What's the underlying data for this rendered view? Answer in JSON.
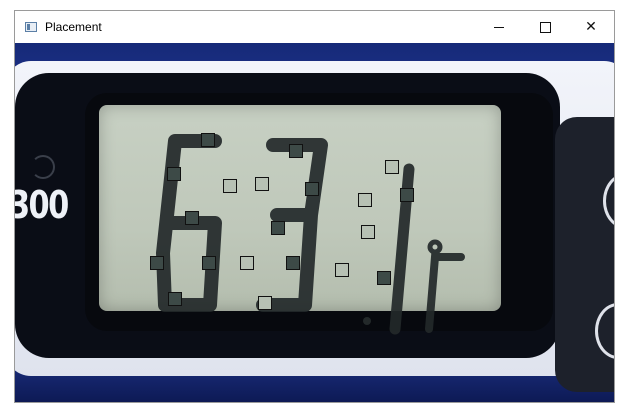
{
  "window": {
    "title": "Placement",
    "controls": {
      "minimize_icon": "minimize-icon",
      "maximize_icon": "maximize-icon",
      "close_icon": "close-icon",
      "close_glyph": "✕"
    }
  },
  "photo": {
    "brand_digits": "300",
    "reading": "63.1c"
  },
  "markers": {
    "colors": {
      "dark": "#3d4a47",
      "light": "#b7c1b4"
    },
    "items": [
      {
        "tone": "dark"
      },
      {
        "tone": "dark"
      },
      {
        "tone": "light"
      },
      {
        "tone": "dark"
      },
      {
        "tone": "light"
      },
      {
        "tone": "light"
      },
      {
        "tone": "dark"
      },
      {
        "tone": "light"
      },
      {
        "tone": "dark"
      },
      {
        "tone": "dark"
      },
      {
        "tone": "dark"
      },
      {
        "tone": "light"
      },
      {
        "tone": "dark"
      },
      {
        "tone": "dark"
      },
      {
        "tone": "light"
      },
      {
        "tone": "dark"
      },
      {
        "tone": "light"
      },
      {
        "tone": "dark"
      },
      {
        "tone": "dark"
      },
      {
        "tone": "light"
      }
    ]
  }
}
